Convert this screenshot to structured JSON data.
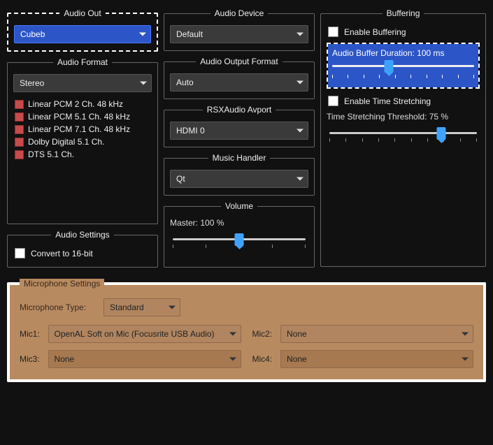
{
  "audio_out": {
    "legend": "Audio Out",
    "value": "Cubeb"
  },
  "audio_device": {
    "legend": "Audio Device",
    "value": "Default"
  },
  "buffering": {
    "legend": "Buffering",
    "enable_label": "Enable Buffering",
    "duration_label": "Audio Buffer Duration: 100 ms",
    "duration_percent": 40,
    "enable_stretch_label": "Enable Time Stretching",
    "stretch_thresh_label": "Time Stretching Threshold: 75 %",
    "stretch_percent": 75
  },
  "audio_format": {
    "legend": "Audio Format",
    "value": "Stereo",
    "items": [
      "Linear PCM 2 Ch. 48 kHz",
      "Linear PCM 5.1 Ch. 48 kHz",
      "Linear PCM 7.1 Ch. 48 kHz",
      "Dolby Digital 5.1 Ch.",
      "DTS 5.1 Ch."
    ]
  },
  "audio_output_format": {
    "legend": "Audio Output Format",
    "value": "Auto"
  },
  "rsx_avport": {
    "legend": "RSXAudio Avport",
    "value": "HDMI 0"
  },
  "music_handler": {
    "legend": "Music Handler",
    "value": "Qt"
  },
  "volume": {
    "legend": "Volume",
    "label": "Master: 100 %",
    "percent": 50
  },
  "audio_settings": {
    "legend": "Audio Settings",
    "convert_label": "Convert to 16-bit"
  },
  "mic": {
    "legend": "Microphone Settings",
    "type_label": "Microphone Type:",
    "type_value": "Standard",
    "mic1_label": "Mic1:",
    "mic1_value": "OpenAL Soft on Mic (Focusrite USB Audio)",
    "mic2_label": "Mic2:",
    "mic2_value": "None",
    "mic3_label": "Mic3:",
    "mic3_value": "None",
    "mic4_label": "Mic4:",
    "mic4_value": "None"
  }
}
